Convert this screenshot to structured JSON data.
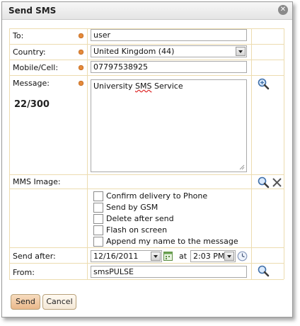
{
  "dialog": {
    "title": "Send SMS",
    "close_icon": "close-icon"
  },
  "form": {
    "to": {
      "label": "To:",
      "value": "user"
    },
    "country": {
      "label": "Country:",
      "value": "United Kingdom (44)"
    },
    "mobile": {
      "label": "Mobile/Cell:",
      "value": "07797538925"
    },
    "message": {
      "label": "Message:",
      "text_start": "University ",
      "text_misspelled": "SMS",
      "text_end": " Service",
      "counter": "22/300"
    },
    "mms": {
      "label": "MMS Image:"
    },
    "options": [
      {
        "label": "Confirm delivery to Phone",
        "checked": false
      },
      {
        "label": "Send by GSM",
        "checked": false
      },
      {
        "label": "Delete after send",
        "checked": false
      },
      {
        "label": "Flash on screen",
        "checked": false
      },
      {
        "label": "Append my name to the message",
        "checked": false
      }
    ],
    "send_after": {
      "label": "Send after:",
      "date": "12/16/2011",
      "at_label": "at",
      "time": "2:03 PM"
    },
    "from": {
      "label": "From:",
      "value": "smsPULSE"
    }
  },
  "buttons": {
    "send": "Send",
    "cancel": "Cancel"
  },
  "colors": {
    "required_dot": "#e58a3a",
    "separator": "#ecdcb0",
    "send_button": "#f2caa0",
    "cancel_button": "#fbf4ea"
  },
  "icons": [
    "zoom-icon",
    "search-icon",
    "clear-icon",
    "calendar-icon",
    "clock-icon",
    "dropdown-arrow-icon"
  ]
}
